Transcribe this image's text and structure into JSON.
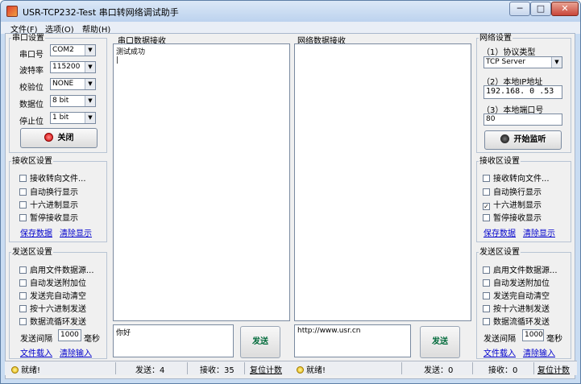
{
  "window": {
    "title": "USR-TCP232-Test 串口转网络调试助手",
    "min": "─",
    "max": "□",
    "close": "✕"
  },
  "menu": [
    "文件(F)",
    "选项(O)",
    "帮助(H)"
  ],
  "serial_settings": {
    "title": "串口设置",
    "rows": [
      {
        "label": "串口号",
        "value": "COM2"
      },
      {
        "label": "波特率",
        "value": "115200"
      },
      {
        "label": "校验位",
        "value": "NONE"
      },
      {
        "label": "数据位",
        "value": "8 bit"
      },
      {
        "label": "停止位",
        "value": "1 bit"
      }
    ],
    "button": "关闭"
  },
  "left_recv": {
    "title": "接收区设置",
    "options": [
      {
        "label": "接收转向文件...",
        "checked": false
      },
      {
        "label": "自动换行显示",
        "checked": false
      },
      {
        "label": "十六进制显示",
        "checked": false
      },
      {
        "label": "暂停接收显示",
        "checked": false
      }
    ],
    "links": [
      "保存数据",
      "清除显示"
    ]
  },
  "left_send": {
    "title": "发送区设置",
    "options": [
      {
        "label": "启用文件数据源...",
        "checked": false
      },
      {
        "label": "自动发送附加位",
        "checked": false
      },
      {
        "label": "发送完自动清空",
        "checked": false
      },
      {
        "label": "按十六进制发送",
        "checked": false
      },
      {
        "label": "数据流循环发送",
        "checked": false
      }
    ],
    "interval_label": "发送间隔",
    "interval_value": "1000",
    "interval_unit": "毫秒",
    "links": [
      "文件载入",
      "清除输入"
    ]
  },
  "serial_recv_panel": {
    "title": "串口数据接收",
    "content": "测试成功"
  },
  "net_recv_panel": {
    "title": "网络数据接收",
    "content": ""
  },
  "serial_send": {
    "content": "你好",
    "button": "发送"
  },
  "net_send": {
    "content": "http://www.usr.cn",
    "button": "发送"
  },
  "net_settings": {
    "title": "网络设置",
    "protocol_label": "（1）协议类型",
    "protocol_value": "TCP Server",
    "ip_label": "（2）本地IP地址",
    "ip_value": "192.168. 0 .53",
    "port_label": "（3）本地端口号",
    "port_value": "80",
    "button": "开始监听"
  },
  "right_recv": {
    "title": "接收区设置",
    "options": [
      {
        "label": "接收转向文件...",
        "checked": false
      },
      {
        "label": "自动换行显示",
        "checked": false
      },
      {
        "label": "十六进制显示",
        "checked": true
      },
      {
        "label": "暂停接收显示",
        "checked": false
      }
    ],
    "links": [
      "保存数据",
      "清除显示"
    ]
  },
  "right_send": {
    "title": "发送区设置",
    "options": [
      {
        "label": "启用文件数据源...",
        "checked": false
      },
      {
        "label": "自动发送附加位",
        "checked": false
      },
      {
        "label": "发送完自动清空",
        "checked": false
      },
      {
        "label": "按十六进制发送",
        "checked": false
      },
      {
        "label": "数据流循环发送",
        "checked": false
      }
    ],
    "interval_label": "发送间隔",
    "interval_value": "1000",
    "interval_unit": "毫秒",
    "links": [
      "文件载入",
      "清除输入"
    ]
  },
  "status": {
    "left_ready": "就绪!",
    "left_sent": "发送：4",
    "left_recv": "接收：35",
    "left_reset": "复位计数",
    "right_ready": "就绪!",
    "right_sent": "发送：0",
    "right_recv": "接收：0",
    "right_reset": "复位计数"
  }
}
